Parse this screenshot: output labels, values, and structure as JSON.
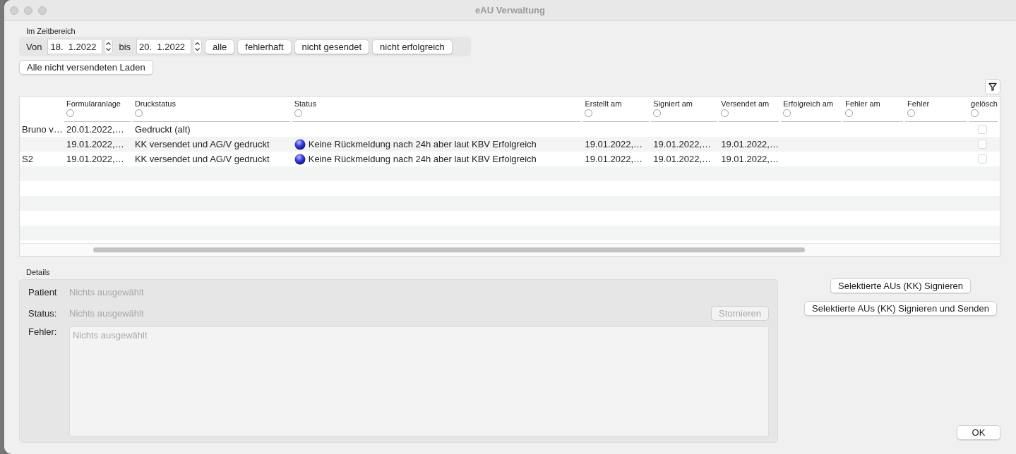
{
  "window": {
    "title": "eAU Verwaltung"
  },
  "zeitbereich": {
    "label": "Im Zeitbereich",
    "from_label": "Von",
    "from": "18.  1.2022",
    "to_label": "bis",
    "to": "20.  1.2022",
    "filters": [
      "alle",
      "fehlerhaft",
      "nicht gesendet",
      "nicht erfolgreich"
    ]
  },
  "load_button": "Alle nicht versendeten Laden",
  "table": {
    "columns": [
      {
        "label": "Formularanlage",
        "filter_selected": false
      },
      {
        "label": "Druckstatus",
        "filter_selected": false
      },
      {
        "label": "Status",
        "filter_selected": false
      },
      {
        "label": "Erstellt am",
        "filter_selected": false
      },
      {
        "label": "Signiert am",
        "filter_selected": false
      },
      {
        "label": "Versendet am",
        "filter_selected": false
      },
      {
        "label": "Erfolgreich am",
        "filter_selected": false
      },
      {
        "label": "Fehler am",
        "filter_selected": false
      },
      {
        "label": "Fehler",
        "filter_selected": false
      },
      {
        "label": "gelösch",
        "filter_selected": false
      }
    ],
    "rows": [
      {
        "column_1": "Bruno v…",
        "formularanlage": "20.01.2022,…",
        "druckstatus": "Gedruckt (alt)",
        "status_indicator": false,
        "geloescht": false
      },
      {
        "formularanlage": "19.01.2022,…",
        "druckstatus": "KK versendet und AG/V gedruckt",
        "status": "Keine Rückmeldung nach 24h aber laut KBV Erfolgreich",
        "status_indicator": true,
        "erstellt": "19.01.2022,…",
        "signiert": "19.01.2022,…",
        "versendet": "19.01.2022,…",
        "geloescht": false
      },
      {
        "column_1": "S2",
        "formularanlage": "19.01.2022,…",
        "druckstatus": "KK versendet und AG/V gedruckt",
        "status": "Keine Rückmeldung nach 24h aber laut KBV Erfolgreich",
        "status_indicator": true,
        "erstellt": "19.01.2022,…",
        "signiert": "19.01.2022,…",
        "versendet": "19.01.2022,…",
        "geloescht": false
      }
    ]
  },
  "details": {
    "label": "Details",
    "patient": {
      "label": "Patient",
      "value": "Nichts ausgewählt"
    },
    "status": {
      "label": "Status:",
      "value": "Nichts ausgewählt"
    },
    "cancel_button": {
      "label": "Stornieren",
      "disabled": true
    },
    "fehler": {
      "label": "Fehler:",
      "placeholder": "Nichts ausgewählt"
    }
  },
  "actions": [
    "Selektierte AUs (KK) Signieren",
    "Selektierte AUs (KK) Signieren und Senden"
  ],
  "ok_button": "OK"
}
